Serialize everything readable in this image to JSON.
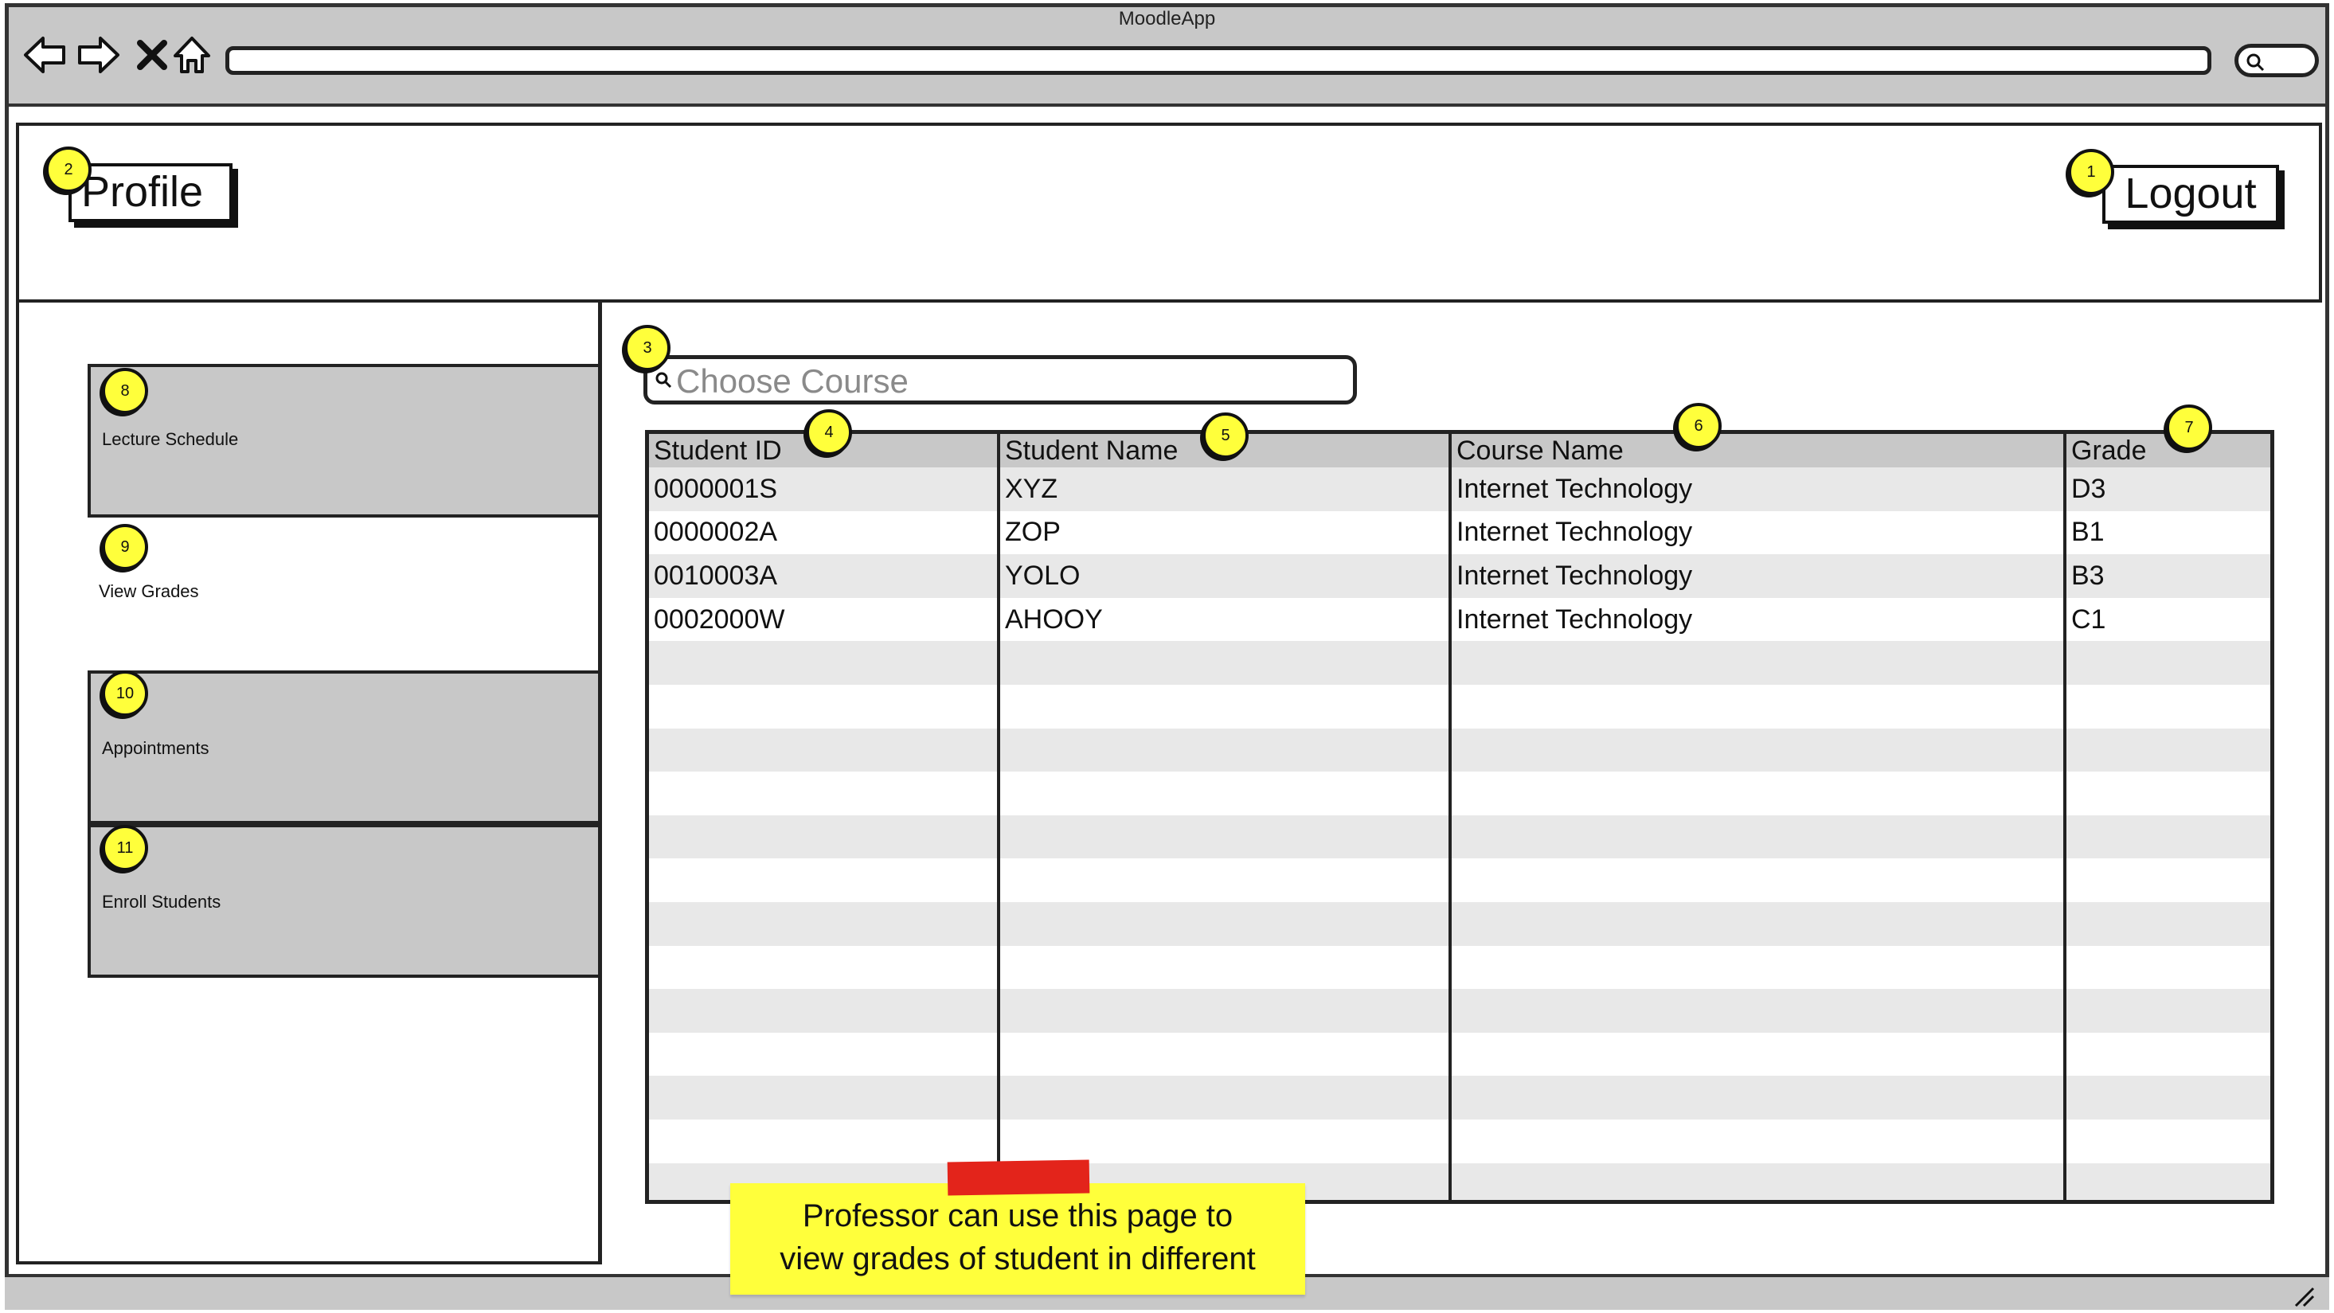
{
  "window": {
    "title": "MoodleApp"
  },
  "browser": {
    "icons": [
      "back-arrow-icon",
      "forward-arrow-icon",
      "close-icon",
      "home-icon",
      "search-icon",
      "resize-grip-icon"
    ]
  },
  "header": {
    "profile_label": "Profile",
    "logout_label": "Logout"
  },
  "sidebar": {
    "items": [
      {
        "label": "Lecture Schedule",
        "marker": "8"
      },
      {
        "label": "View Grades",
        "marker": "9"
      },
      {
        "label": "Appointments",
        "marker": "10"
      },
      {
        "label": "Enroll Students",
        "marker": "11"
      }
    ]
  },
  "markers": {
    "logout": "1",
    "profile": "2",
    "course_search": "3",
    "col_id": "4",
    "col_name": "5",
    "col_course": "6",
    "col_grade": "7"
  },
  "search": {
    "placeholder": "Choose Course"
  },
  "table": {
    "headers": [
      "Student ID",
      "Student Name",
      "Course Name",
      "Grade"
    ],
    "rows": [
      [
        "0000001S",
        "XYZ",
        "Internet Technology",
        "D3"
      ],
      [
        "0000002A",
        "ZOP",
        "Internet Technology",
        "B1"
      ],
      [
        "0010003A",
        "YOLO",
        "Internet Technology",
        "B3"
      ],
      [
        "0002000W",
        "AHOOY",
        "Internet Technology",
        "C1"
      ]
    ]
  },
  "note": {
    "line1": "Professor can use this page to",
    "line2": "view grades of student in different"
  },
  "colors": {
    "chrome_gray": "#c8c8c8",
    "marker_yellow": "#ffff3b",
    "tape_red": "#e3241b",
    "row_stripe": "#e8e8e8"
  }
}
